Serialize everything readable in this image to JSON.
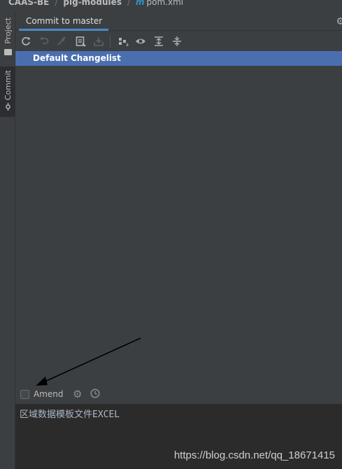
{
  "breadcrumb": {
    "items": [
      "CAAS-BE",
      "pig-modules",
      "pom.xml"
    ],
    "separator": "/",
    "file_icon": "m"
  },
  "tool_strip": {
    "tabs": [
      {
        "label": "Project",
        "icon": "folder-icon"
      },
      {
        "label": "Commit",
        "icon": "commit-icon"
      }
    ]
  },
  "commit_panel": {
    "tab_label": "Commit to master",
    "toolbar": [
      "refresh-icon",
      "rollback-icon",
      "update-icon",
      "diff-icon",
      "shelve-icon",
      "group-by-icon",
      "view-options-icon",
      "expand-all-icon",
      "collapse-all-icon"
    ],
    "changelist": {
      "selected": "Default Changelist"
    },
    "amend": {
      "label": "Amend",
      "checked": false
    },
    "commit_message": "区域数据模板文件EXCEL"
  },
  "watermark": "https://blog.csdn.net/qq_18671415",
  "colors": {
    "background": "#3c3f41",
    "selection": "#4b6eaf",
    "tab_underline": "#4a88c7",
    "editor_background": "#2b2b2b"
  }
}
